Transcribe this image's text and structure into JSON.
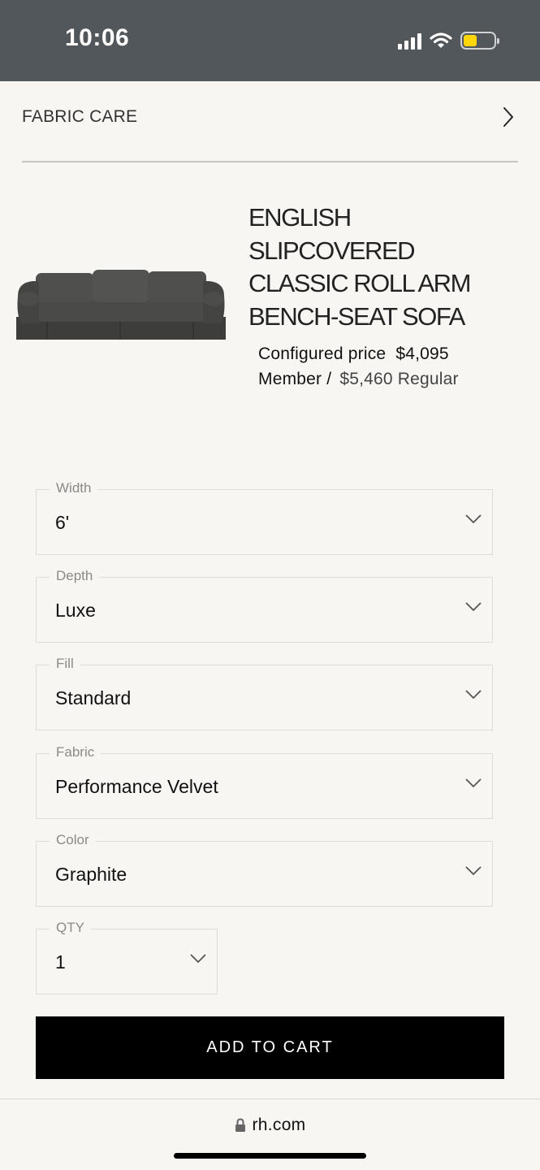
{
  "status_bar": {
    "time": "10:06",
    "icons": [
      "signal-icon",
      "wifi-icon",
      "battery-icon"
    ],
    "battery_color": "#ffd60a"
  },
  "fabric_care": {
    "label": "FABRIC CARE",
    "icon": "chevron-right-icon"
  },
  "product": {
    "title_lines": [
      "ENGLISH",
      "SLIPCOVERED",
      "CLASSIC ROLL ARM",
      "BENCH-SEAT SOFA"
    ],
    "configured_label": "Configured price",
    "configured_price": "$4,095",
    "member_label": "Member /",
    "regular_price": "$5,460 Regular"
  },
  "options": [
    {
      "label": "Width",
      "value": "6'"
    },
    {
      "label": "Depth",
      "value": "Luxe"
    },
    {
      "label": "Fill",
      "value": "Standard"
    },
    {
      "label": "Fabric",
      "value": "Performance Velvet"
    },
    {
      "label": "Color",
      "value": "Graphite"
    }
  ],
  "qty": {
    "label": "QTY",
    "value": "1"
  },
  "cta": {
    "label": "ADD TO CART"
  },
  "browser": {
    "url": "rh.com",
    "icon": "lock-icon"
  }
}
